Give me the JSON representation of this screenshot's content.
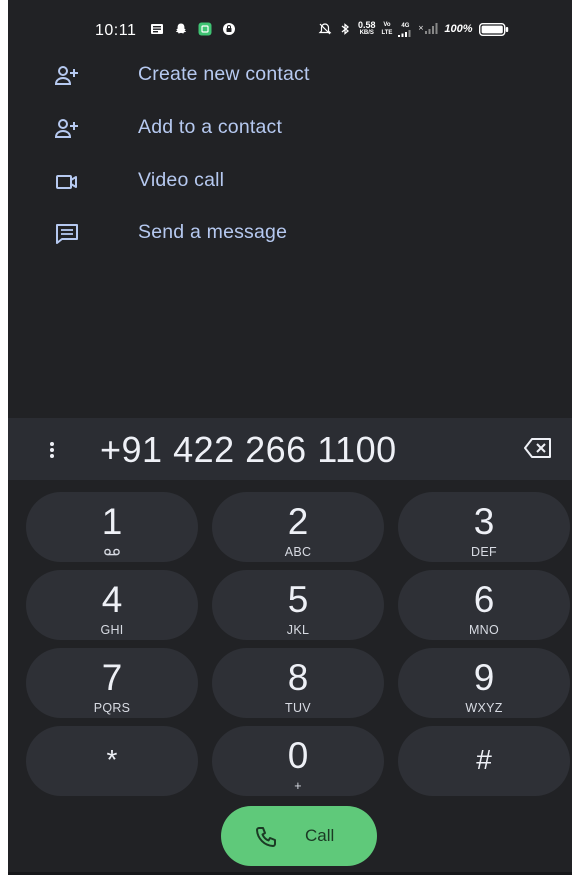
{
  "status_bar": {
    "time": "10:11",
    "network_speed": "0.58",
    "network_speed_unit": "KB/S",
    "volte_top": "Vo",
    "volte_bottom": "LTE",
    "signal_label": "4G",
    "battery_percent": "100%"
  },
  "menu": {
    "items": [
      {
        "label": "Create new contact",
        "icon": "person-add-icon"
      },
      {
        "label": "Add to a contact",
        "icon": "person-add-icon"
      },
      {
        "label": "Video call",
        "icon": "videocam-icon"
      },
      {
        "label": "Send a message",
        "icon": "message-icon"
      }
    ]
  },
  "dialer": {
    "number": "+91 422 266 1100"
  },
  "keypad": {
    "keys": [
      {
        "digit": "1",
        "letters": ""
      },
      {
        "digit": "2",
        "letters": "ABC"
      },
      {
        "digit": "3",
        "letters": "DEF"
      },
      {
        "digit": "4",
        "letters": "GHI"
      },
      {
        "digit": "5",
        "letters": "JKL"
      },
      {
        "digit": "6",
        "letters": "MNO"
      },
      {
        "digit": "7",
        "letters": "PQRS"
      },
      {
        "digit": "8",
        "letters": "TUV"
      },
      {
        "digit": "9",
        "letters": "WXYZ"
      },
      {
        "digit": "*",
        "letters": ""
      },
      {
        "digit": "0",
        "letters": "+"
      },
      {
        "digit": "#",
        "letters": ""
      }
    ]
  },
  "call_button": {
    "label": "Call"
  },
  "colors": {
    "background": "#212225",
    "number_row": "#2b2d33",
    "key": "#2e3036",
    "accent_text": "#b6c9f0",
    "call_green": "#5fc97a"
  }
}
